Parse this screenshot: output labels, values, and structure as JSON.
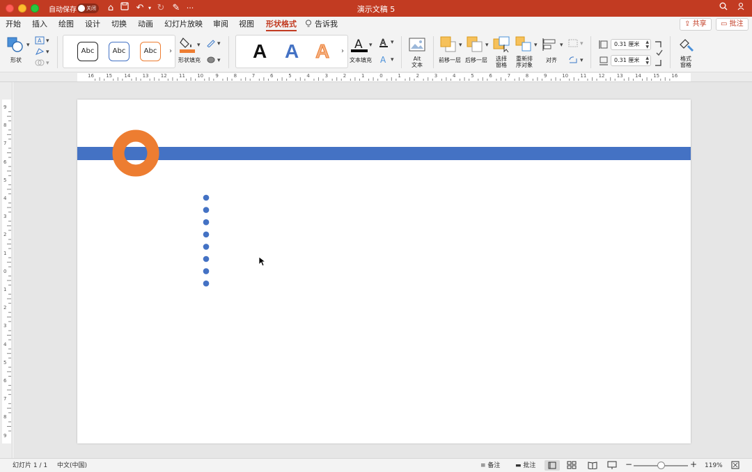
{
  "window": {
    "autosave_label": "自动保存",
    "autosave_state": "关闭",
    "title": "演示文稿 5",
    "more": "···"
  },
  "tabs": [
    {
      "label": "开始"
    },
    {
      "label": "插入"
    },
    {
      "label": "绘图"
    },
    {
      "label": "设计"
    },
    {
      "label": "切换"
    },
    {
      "label": "动画"
    },
    {
      "label": "幻灯片放映"
    },
    {
      "label": "审阅"
    },
    {
      "label": "视图"
    },
    {
      "label": "形状格式"
    },
    {
      "label": "告诉我"
    }
  ],
  "share_label": "共享",
  "comments_label": "批注",
  "ribbon": {
    "shapes_label": "形状",
    "style_samples": [
      "Abc",
      "Abc",
      "Abc"
    ],
    "shape_fill_label": "形状填充",
    "wordart_samples": [
      "A",
      "A",
      "A"
    ],
    "text_fill_label": "文本填充",
    "alt_text_label_1": "Alt",
    "alt_text_label_2": "文本",
    "bring_forward_label": "前移一层",
    "send_backward_label": "后移一层",
    "selection_pane_label_1": "选择",
    "selection_pane_label_2": "窗格",
    "reorder_label_1": "重新排",
    "reorder_label_2": "序对象",
    "align_label": "对齐",
    "height_value": "0.31 厘米",
    "width_value": "0.31 厘米",
    "format_pane_label_1": "格式",
    "format_pane_label_2": "窗格"
  },
  "ruler": {
    "h_ticks": [
      "16",
      "15",
      "14",
      "13",
      "12",
      "11",
      "10",
      "9",
      "8",
      "7",
      "6",
      "5",
      "4",
      "3",
      "2",
      "1",
      "0",
      "1",
      "2",
      "3",
      "4",
      "5",
      "6",
      "7",
      "8",
      "9",
      "10",
      "11",
      "12",
      "13",
      "14",
      "15",
      "16"
    ],
    "v_ticks": [
      "9",
      "8",
      "7",
      "6",
      "5",
      "4",
      "3",
      "2",
      "1",
      "0",
      "1",
      "2",
      "3",
      "4",
      "5",
      "6",
      "7",
      "8",
      "9"
    ]
  },
  "colors": {
    "accent": "#c23b22",
    "bar_blue": "#4472c4",
    "ring_orange": "#ed7d31",
    "dot_blue": "#4472c4"
  },
  "slide": {
    "dot_count": 8
  },
  "status": {
    "slide_info": "幻灯片 1 / 1",
    "language": "中文(中国)",
    "notes_label": "备注",
    "comments_label": "批注",
    "zoom": "119%"
  }
}
